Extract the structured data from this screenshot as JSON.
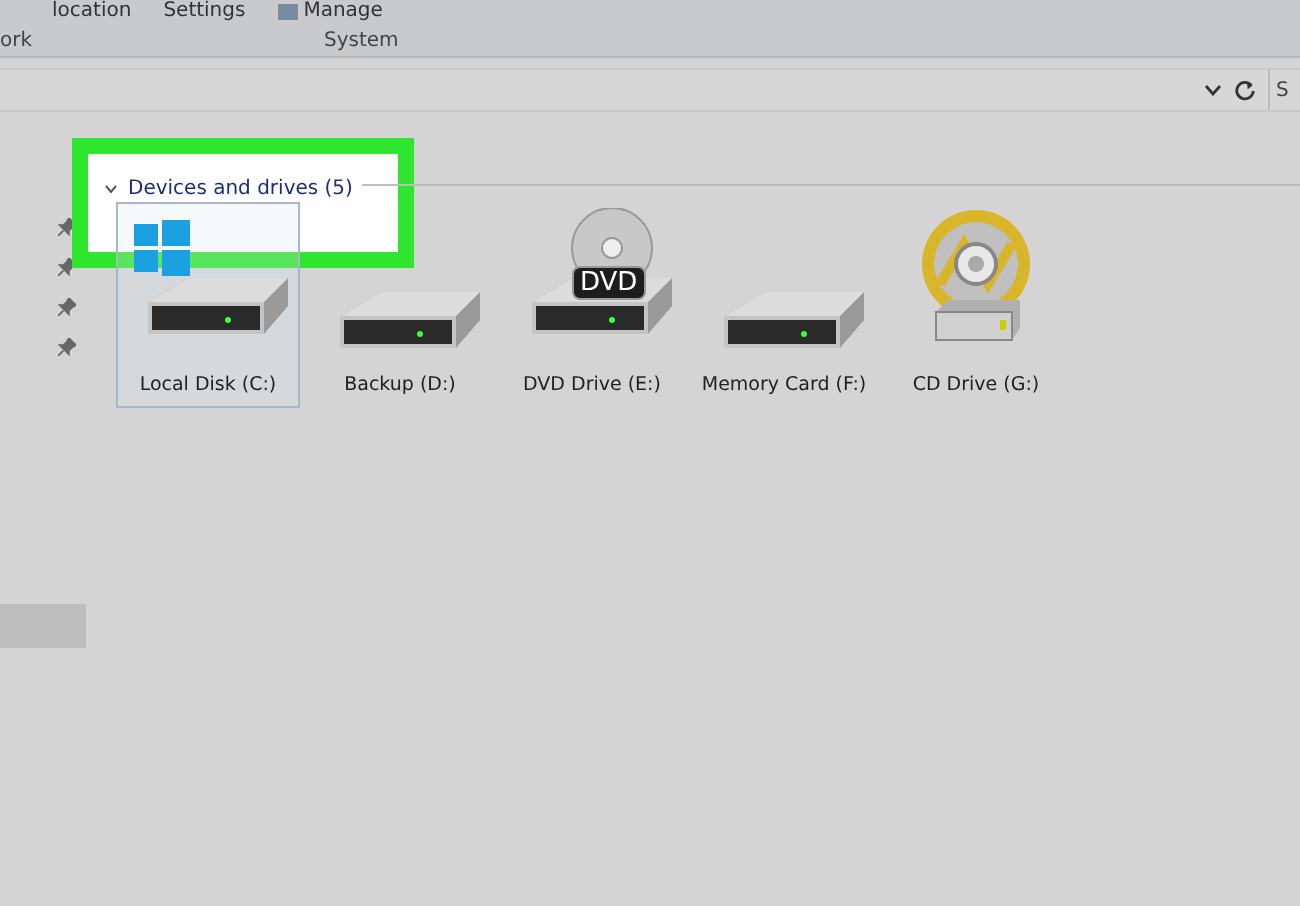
{
  "ribbon": {
    "top_row": [
      "location",
      "Settings",
      "Manage"
    ],
    "group_labels": [
      "ork",
      "System"
    ]
  },
  "address_bar": {
    "search_placeholder": "S"
  },
  "quick_access": {
    "highlighted_item_selected": true
  },
  "section": {
    "title": "Devices and drives (5)",
    "expanded": true
  },
  "drives": [
    {
      "label": "Local Disk (C:)",
      "kind": "system",
      "selected": true
    },
    {
      "label": "Backup (D:)",
      "kind": "hdd",
      "selected": false
    },
    {
      "label": "DVD Drive (E:)",
      "kind": "dvd",
      "badge": "DVD",
      "selected": false
    },
    {
      "label": "Memory Card (F:)",
      "kind": "hdd",
      "selected": false
    },
    {
      "label": "CD Drive (G:)",
      "kind": "cd",
      "selected": false
    }
  ]
}
